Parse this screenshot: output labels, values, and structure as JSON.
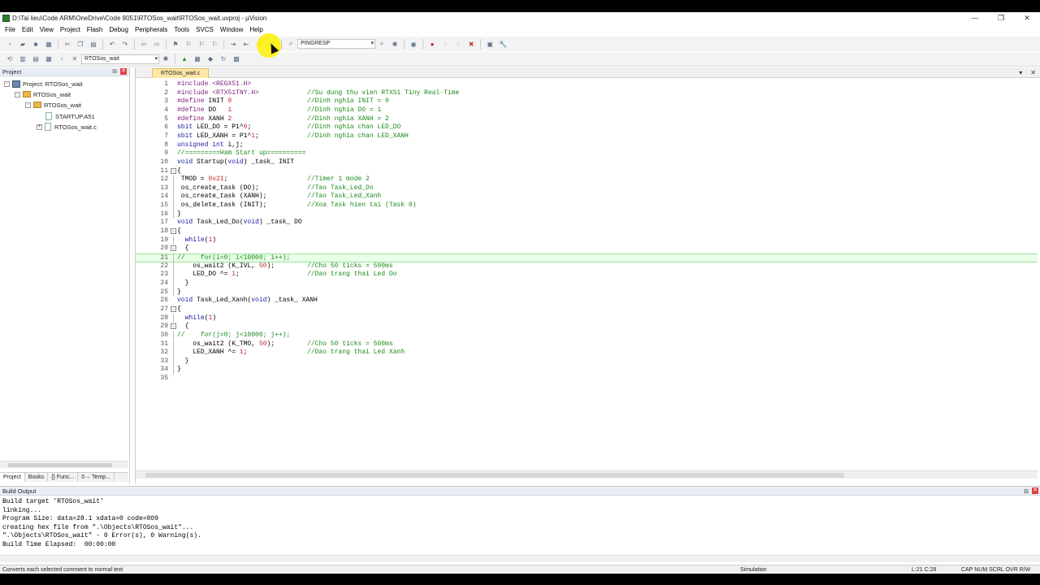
{
  "window": {
    "title": "D:\\Tai lieu\\Code ARM\\OneDrive\\Code 8051\\RTOSos_wait\\RTOSos_wait.uvproj - µVision",
    "minimize": "—",
    "maximize": "❐",
    "close": "✕"
  },
  "menu": [
    "File",
    "Edit",
    "View",
    "Project",
    "Flash",
    "Debug",
    "Peripherals",
    "Tools",
    "SVCS",
    "Window",
    "Help"
  ],
  "toolbar": {
    "find_combo": "PINGRESP",
    "target_combo": "RTOSos_wait"
  },
  "project_pane": {
    "header": "Project",
    "tree": [
      {
        "label": "Project: RTOSos_wait",
        "level": 0,
        "kind": "project",
        "expander": "-"
      },
      {
        "label": "RTOSos_wait",
        "level": 1,
        "kind": "folder",
        "expander": "-"
      },
      {
        "label": "RTOSos_wait",
        "level": 2,
        "kind": "folder",
        "expander": "-"
      },
      {
        "label": "STARTUP.A51",
        "level": 3,
        "kind": "file",
        "expander": ""
      },
      {
        "label": "RTOSos_wait.c",
        "level": 3,
        "kind": "file",
        "expander": "+"
      }
    ],
    "tabs": [
      "Project",
      "Books",
      "{} Func...",
      "0→ Temp..."
    ]
  },
  "editor": {
    "tab_label": "RTOSos_wait.c",
    "current_line": 21,
    "lines": [
      {
        "n": "1",
        "fold": "",
        "code": "#include <REGX51.H>",
        "comment": ""
      },
      {
        "n": "2",
        "fold": "",
        "code": "#include <RTX51TNY.H>",
        "comment": "//Su dung thu vien RTX51 Tiny Real-Time"
      },
      {
        "n": "3",
        "fold": "",
        "code": "#define INIT 0",
        "comment": "//Dinh nghia INIT = 0"
      },
      {
        "n": "4",
        "fold": "",
        "code": "#define DO   1",
        "comment": "//Dinh nghia DO = 1"
      },
      {
        "n": "5",
        "fold": "",
        "code": "#define XANH 2",
        "comment": "//Dinh nghia XANH = 2"
      },
      {
        "n": "6",
        "fold": "",
        "code": "sbit LED_DO = P1^0;",
        "comment": "//Dinh nghia chan LED_DO"
      },
      {
        "n": "7",
        "fold": "",
        "code": "sbit LED_XANH = P1^1;",
        "comment": "//Dinh nghia chan LED_XANH"
      },
      {
        "n": "8",
        "fold": "",
        "code": "unsigned int i,j;",
        "comment": ""
      },
      {
        "n": "9",
        "fold": "",
        "code": "//=========Ham Start up==========",
        "comment": ""
      },
      {
        "n": "10",
        "fold": "",
        "code": "void Startup(void) _task_ INIT",
        "comment": ""
      },
      {
        "n": "11",
        "fold": "-",
        "code": "{",
        "comment": ""
      },
      {
        "n": "12",
        "fold": "|",
        "code": " TMOD = 0x21;",
        "comment": "//Timer 1 mode 2"
      },
      {
        "n": "13",
        "fold": "|",
        "code": " os_create_task (DO);",
        "comment": "//Tao Task_Led_Do"
      },
      {
        "n": "14",
        "fold": "|",
        "code": " os_create_task (XANH);",
        "comment": "//Tao Task_Led_Xanh"
      },
      {
        "n": "15",
        "fold": "|",
        "code": " os_delete_task (INIT);",
        "comment": "//Xoa Task hien tai (Task 0)"
      },
      {
        "n": "16",
        "fold": "|",
        "code": "}",
        "comment": ""
      },
      {
        "n": "17",
        "fold": "",
        "code": "void Task_Led_Do(void) _task_ DO",
        "comment": ""
      },
      {
        "n": "18",
        "fold": "-",
        "code": "{",
        "comment": ""
      },
      {
        "n": "19",
        "fold": "|",
        "code": "  while(1)",
        "comment": ""
      },
      {
        "n": "20",
        "fold": "-",
        "code": "  {",
        "comment": ""
      },
      {
        "n": "21",
        "fold": "|",
        "code": "//    for(i=0; i<10000; i++);",
        "comment": ""
      },
      {
        "n": "22",
        "fold": "|",
        "code": "    os_wait2 (K_IVL, 50);",
        "comment": "//Cho 50 ticks = 500ms"
      },
      {
        "n": "23",
        "fold": "|",
        "code": "    LED_DO ^= 1;",
        "comment": "//Dao trang thai Led Do"
      },
      {
        "n": "24",
        "fold": "|",
        "code": "  }",
        "comment": ""
      },
      {
        "n": "25",
        "fold": "|",
        "code": "}",
        "comment": ""
      },
      {
        "n": "26",
        "fold": "",
        "code": "void Task_Led_Xanh(void) _task_ XANH",
        "comment": ""
      },
      {
        "n": "27",
        "fold": "-",
        "code": "{",
        "comment": ""
      },
      {
        "n": "28",
        "fold": "|",
        "code": "  while(1)",
        "comment": ""
      },
      {
        "n": "29",
        "fold": "-",
        "code": "  {",
        "comment": ""
      },
      {
        "n": "30",
        "fold": "|",
        "code": "//    for(j=0; j<10000; j++);",
        "comment": ""
      },
      {
        "n": "31",
        "fold": "|",
        "code": "    os_wait2 (K_TMO, 50);",
        "comment": "//Cho 50 ticks = 500ms"
      },
      {
        "n": "32",
        "fold": "|",
        "code": "    LED_XANH ^= 1;",
        "comment": "//Dao trang thai Led Xanh"
      },
      {
        "n": "33",
        "fold": "|",
        "code": "  }",
        "comment": ""
      },
      {
        "n": "34",
        "fold": "|",
        "code": "}",
        "comment": ""
      },
      {
        "n": "35",
        "fold": "",
        "code": "",
        "comment": ""
      }
    ]
  },
  "build_output": {
    "header": "Build Output",
    "text": "Build target 'RTOSos_wait'\nlinking...\nProgram Size: data=28.1 xdata=0 code=809\ncreating hex file from \".\\Objects\\RTOSos_wait\"...\n\".\\Objects\\RTOSos_wait\" - 0 Error(s), 0 Warning(s).\nBuild Time Elapsed:  00:00:00"
  },
  "status": {
    "hint": "Converts each selected comment to normal text",
    "mode": "Simulation",
    "position": "L:21 C:28",
    "indicators": "CAP  NUM  SCRL  OVR  R/W"
  },
  "colors": {
    "comment": "#1a8a1a",
    "keyword": "#1a1aa6",
    "preprocessor": "#7f1d7f",
    "number": "#c0292b",
    "current_line": "#e8ffe8",
    "selection": "#3399ff",
    "cursor_highlight": "#fff000"
  }
}
